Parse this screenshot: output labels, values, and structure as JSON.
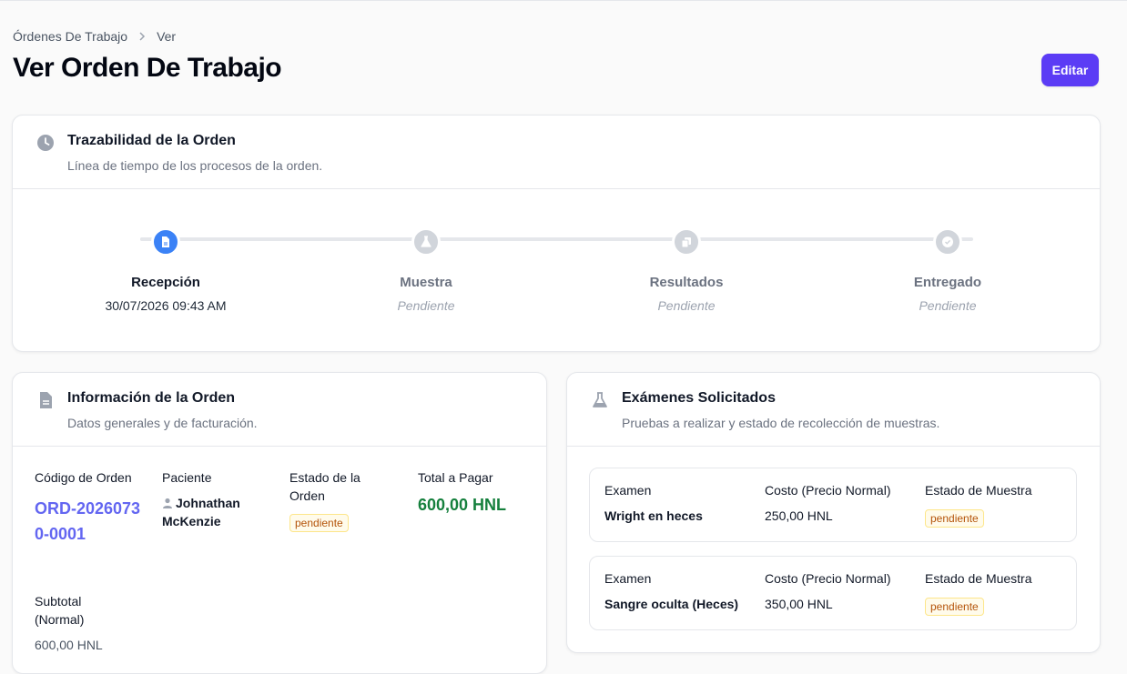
{
  "breadcrumb": {
    "parent": "Órdenes De Trabajo",
    "current": "Ver"
  },
  "page": {
    "title": "Ver Orden De Trabajo",
    "edit_label": "Editar"
  },
  "trace": {
    "title": "Trazabilidad de la Orden",
    "subtitle": "Línea de tiempo de los procesos de la orden.",
    "steps": [
      {
        "label": "Recepción",
        "date": "30/07/2026 09:43 AM",
        "icon": "document-icon",
        "active": true
      },
      {
        "label": "Muestra",
        "date": "Pendiente",
        "icon": "flask-icon",
        "active": false
      },
      {
        "label": "Resultados",
        "date": "Pendiente",
        "icon": "copy-icon",
        "active": false
      },
      {
        "label": "Entregado",
        "date": "Pendiente",
        "icon": "check-icon",
        "active": false
      }
    ]
  },
  "info": {
    "title": "Información de la Orden",
    "subtitle": "Datos generales y de facturación.",
    "code_label": "Código de Orden",
    "code_value": "ORD-20260730-0001",
    "patient_label": "Paciente",
    "patient_value": "Johnathan McKenzie",
    "status_label": "Estado de la Orden",
    "status_value": "pendiente",
    "total_label": "Total a Pagar",
    "total_value": "600,00 HNL",
    "subtotal_label": "Subtotal (Normal)",
    "subtotal_value": "600,00 HNL"
  },
  "exams": {
    "title": "Exámenes Solicitados",
    "subtitle": "Pruebas a realizar y estado de recolección de muestras.",
    "col_exam": "Examen",
    "col_cost": "Costo (Precio Normal)",
    "col_status": "Estado de Muestra",
    "rows": [
      {
        "name": "Wright en heces",
        "cost": "250,00 HNL",
        "status": "pendiente"
      },
      {
        "name": "Sangre oculta (Heces)",
        "cost": "350,00 HNL",
        "status": "pendiente"
      }
    ]
  },
  "colors": {
    "accent": "#5b3cf5",
    "active_step": "#3b82f6",
    "code": "#6366f1",
    "total": "#15803d",
    "badge": "#b45309"
  }
}
